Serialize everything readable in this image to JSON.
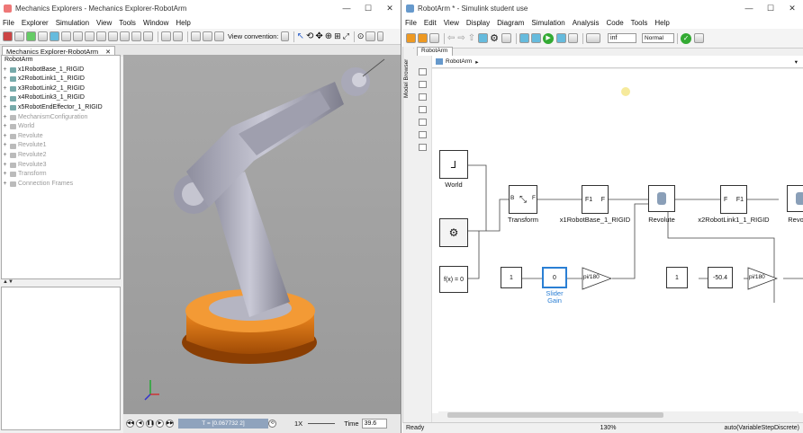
{
  "me": {
    "title": "Mechanics Explorers - Mechanics Explorer-RobotArm",
    "menu": [
      "File",
      "Explorer",
      "Simulation",
      "View",
      "Tools",
      "Window",
      "Help"
    ],
    "view_convention_label": "View convention:",
    "tab": "Mechanics Explorer-RobotArm",
    "tree": [
      {
        "label": "RobotArm",
        "gray": false,
        "root": true
      },
      {
        "label": "x1RobotBase_1_RIGID",
        "gray": false
      },
      {
        "label": "x2RobotLink1_1_RIGID",
        "gray": false
      },
      {
        "label": "x3RobotLink2_1_RIGID",
        "gray": false
      },
      {
        "label": "x4RobotLink3_1_RIGID",
        "gray": false
      },
      {
        "label": "x5RobotEndEffector_1_RIGID",
        "gray": false
      },
      {
        "label": "MechanismConfiguration",
        "gray": true
      },
      {
        "label": "World",
        "gray": true
      },
      {
        "label": "Revolute",
        "gray": true
      },
      {
        "label": "Revolute1",
        "gray": true
      },
      {
        "label": "Revolute2",
        "gray": true
      },
      {
        "label": "Revolute3",
        "gray": true
      },
      {
        "label": "Transform",
        "gray": true
      },
      {
        "label": "Connection Frames",
        "gray": true
      }
    ],
    "time_readout": "T = [0.067732 2]",
    "speed": "1X",
    "time_label": "Time",
    "time_value": "39.6"
  },
  "sl": {
    "title": "RobotArm * - Simulink student use",
    "menu": [
      "File",
      "Edit",
      "View",
      "Display",
      "Diagram",
      "Simulation",
      "Analysis",
      "Code",
      "Tools",
      "Help"
    ],
    "stop_time": "inf",
    "sim_mode": "Normal",
    "tab": "RobotArm",
    "breadcrumb": "RobotArm",
    "model_browser": "Model Browser",
    "blocks": {
      "world_label": "World",
      "transform_label": "Transform",
      "transform_b": "B",
      "transform_f": "F",
      "base_label": "x1RobotBase_1_RIGID",
      "base_in": "F1",
      "base_out": "F",
      "revolute_label": "Revolute",
      "link1_label": "x2RobotLink1_1_RIGID",
      "link1_in": "F",
      "link1_out": "F1",
      "revolute2_label": "Revo",
      "fx": "f(x) = 0",
      "const1": "1",
      "gain1": "0",
      "gain1_label": "Slider\nGain",
      "pi1": "pi/180",
      "const2": "1",
      "gain2": "-50.4",
      "pi2": "pi/180"
    },
    "status_left": "Ready",
    "zoom": "130%",
    "solver": "auto(VariableStepDiscrete)"
  },
  "colors": {
    "base": "#e07810",
    "arm": "#a8a8b8",
    "selected": "#2a7fd4"
  }
}
